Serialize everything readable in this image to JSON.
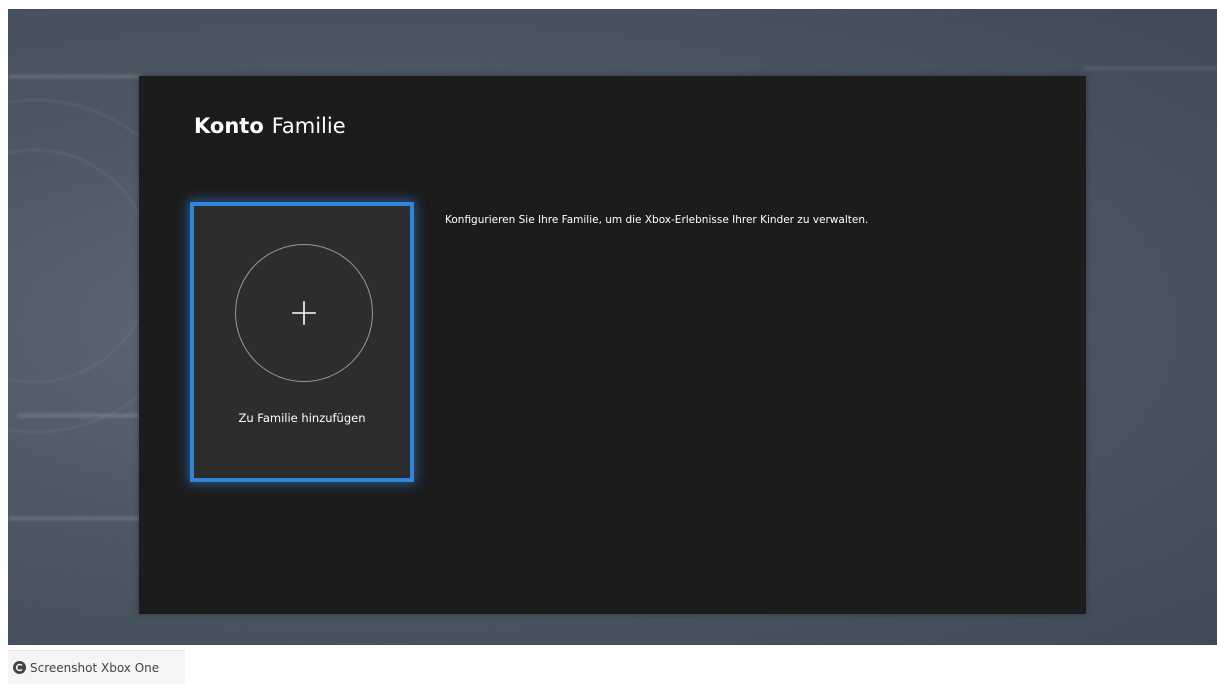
{
  "header": {
    "section": "Konto",
    "page": "Familie"
  },
  "add_family_tile": {
    "icon": "plus-icon",
    "label": "Zu Familie hinzufügen",
    "accent_color": "#2f86d8"
  },
  "description": "Konfigurieren Sie Ihre Familie, um die Xbox-Erlebnisse Ihrer Kinder zu verwalten.",
  "caption": {
    "icon": "copyright-icon",
    "text": "Screenshot Xbox One"
  }
}
